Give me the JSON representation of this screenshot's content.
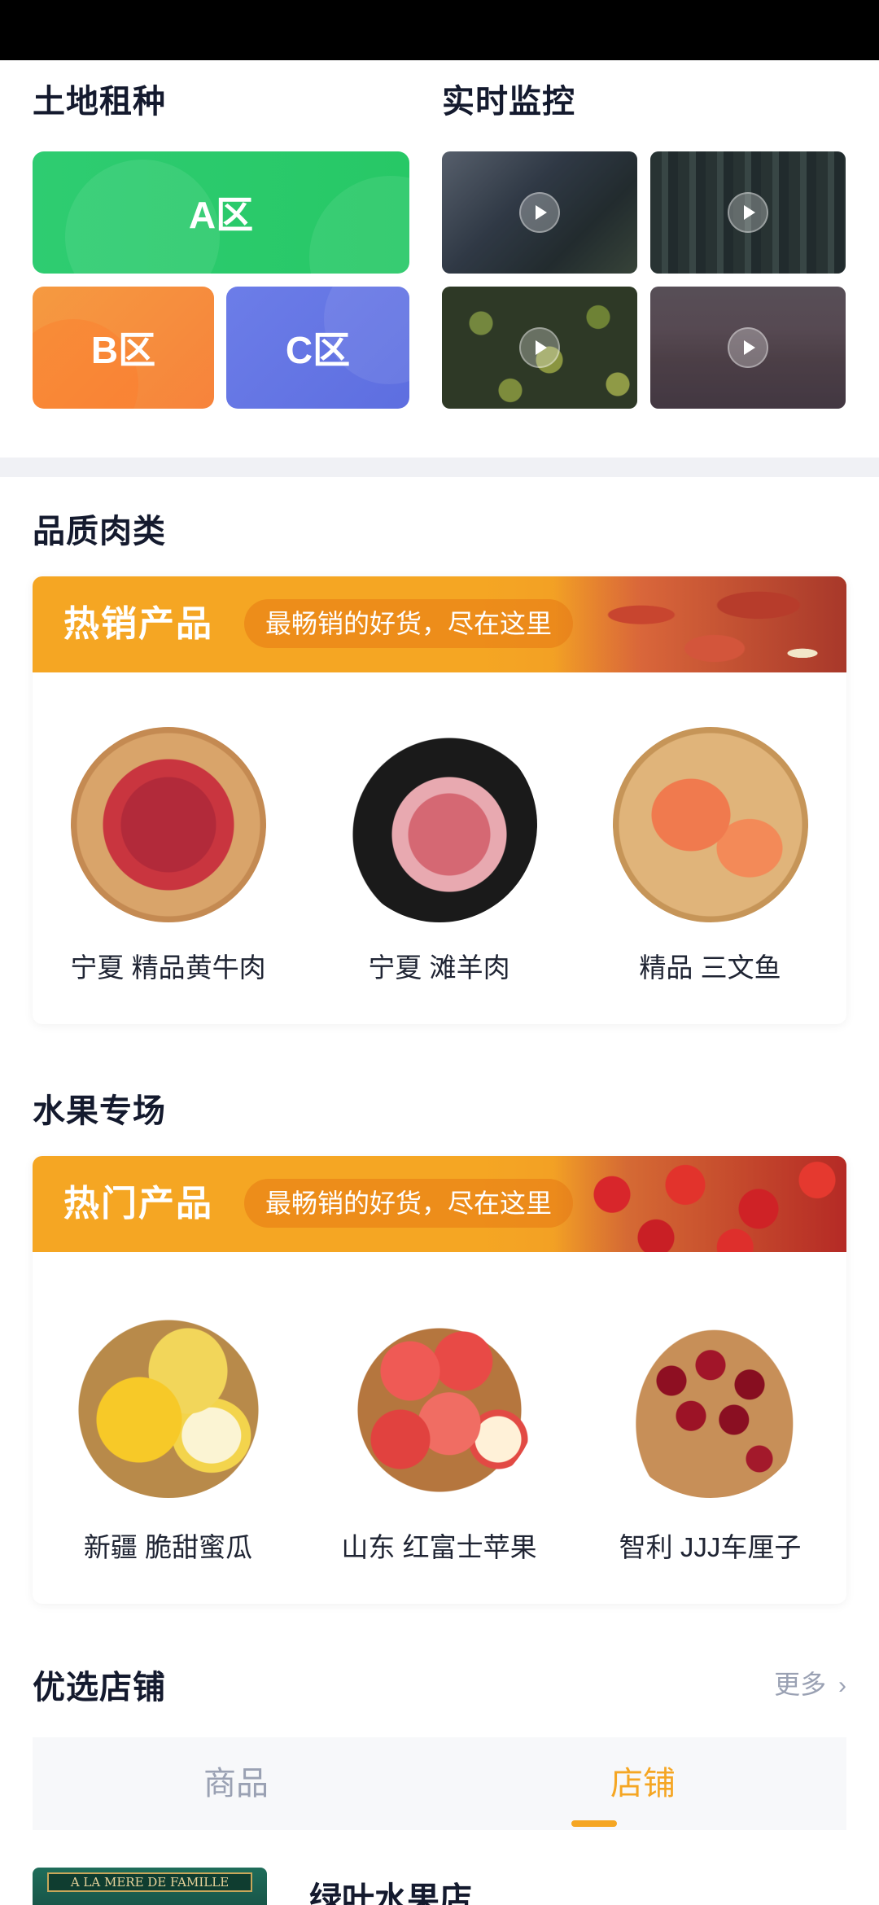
{
  "sections": {
    "land_title": "土地租种",
    "monitor_title": "实时监控",
    "meat_title": "品质肉类",
    "fruit_title": "水果专场",
    "shops_title": "优选店铺"
  },
  "land_zones": [
    "A区",
    "B区",
    "C区"
  ],
  "monitor_videos": [
    "chef-tasting-video",
    "forest-farm-video",
    "green-fruits-video",
    "wheat-field-video"
  ],
  "meat_card": {
    "banner_title": "热销产品",
    "banner_subtitle": "最畅销的好货，尽在这里",
    "products": [
      "宁夏 精品黄牛肉",
      "宁夏 滩羊肉",
      "精品 三文鱼"
    ]
  },
  "fruit_card": {
    "banner_title": "热门产品",
    "banner_subtitle": "最畅销的好货，尽在这里",
    "products": [
      "新疆 脆甜蜜瓜",
      "山东 红富士苹果",
      "智利 JJJ车厘子"
    ]
  },
  "shops": {
    "more_label": "更多",
    "tabs": [
      "商品",
      "店铺"
    ],
    "active_tab": "店铺",
    "first_shop_name": "绿叶水果店",
    "first_shop_sign": "A LA MERE DE FAMILLE"
  },
  "colors": {
    "accent": "#f5a623",
    "zone_a": "#2ecc71",
    "zone_b": "#f7883c",
    "zone_c": "#6474e5",
    "muted": "#9aa1b3"
  }
}
